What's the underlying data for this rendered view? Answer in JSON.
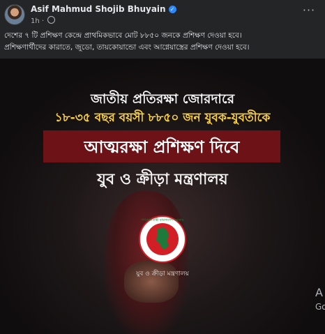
{
  "post": {
    "author": "Asif Mahmud Shojib Bhuyain",
    "time": "1h",
    "separator": "·",
    "more_label": "···",
    "text": "দেশের ৭ টি প্রশিক্ষণ কেন্দ্রে প্রাথমিকভাবে মোট ৮৮৫০ জনকে প্রশিক্ষণ দেওয়া হবে।\nপ্রশিক্ষণার্থীদের কারাতে, জুডো, তায়কোয়ান্ডো এবং আগ্নেয়াস্ত্রের প্রশিক্ষণ দেওয়া হবে।"
  },
  "poster": {
    "line1": "জাতীয় প্রতিরক্ষা জোরদারে",
    "line2": "১৮-৩৫ বছর বয়সী ৮৮৫০ জন যুবক-যুবতীকে",
    "banner": "আত্মরক্ষা প্রশিক্ষণ দিবে",
    "line4": "যুব ও ক্রীড়া মন্ত্রণালয়",
    "emblem_caption": "যুব ও ক্রীড়া মন্ত্রণালয়",
    "emblem_ring_text": "গণপ্রজাতন্ত্রী বাংলাদেশ সরকার",
    "colors": {
      "banner": "#6d1216",
      "highlight": "#ffd43a",
      "emblem_green": "#1d7a3a",
      "emblem_red": "#d21f26"
    }
  },
  "side": {
    "letter1": "A",
    "letter2": "Go"
  },
  "icons": {
    "verified": "verified-badge-icon",
    "globe": "globe-icon",
    "more": "more-options-icon"
  }
}
